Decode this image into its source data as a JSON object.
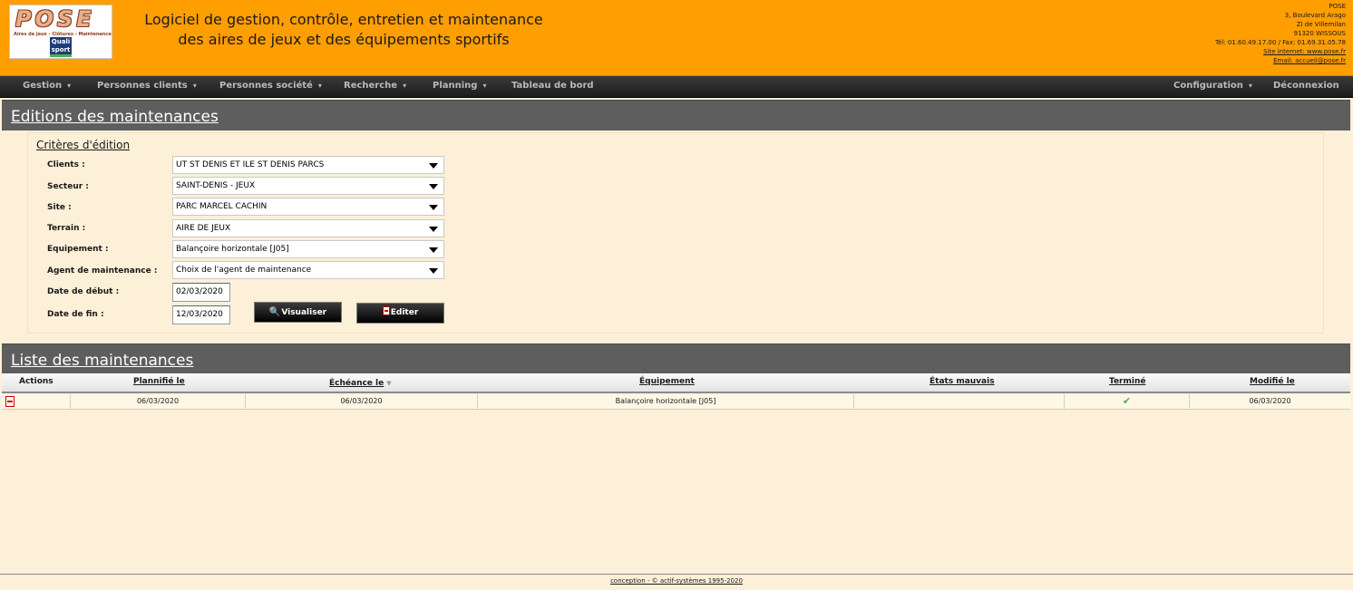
{
  "header": {
    "logo_text": "POSE",
    "logo_tagline": "Aires de jeux - Clôtures - Maintenance",
    "quali_badge": [
      "Quali",
      "sport"
    ],
    "title_line1": "Logiciel de gestion, contrôle, entretien et maintenance",
    "title_line2": "des aires de jeux et des équipements sportifs",
    "company": {
      "name": "POSE",
      "address1": "3, Boulevard Arago",
      "address2": "ZI de Villemilan",
      "city": "91320 WISSOUS",
      "phone": "Tél: 01.60.49.17.00 / Fax: 01.69.31.05.78",
      "website": "Site internet: www.pose.fr",
      "email": "Email: accueil@pose.fr"
    }
  },
  "nav": {
    "items": [
      {
        "label": "Gestion",
        "caret": "▾"
      },
      {
        "label": "Personnes clients",
        "caret": "▾"
      },
      {
        "label": "Personnes société",
        "caret": "▾"
      },
      {
        "label": "Recherche",
        "caret": "▾"
      },
      {
        "label": "Planning",
        "caret": "▾"
      },
      {
        "label": "Tableau de bord",
        "caret": ""
      },
      {
        "label": "Configuration",
        "caret": "▾"
      },
      {
        "label": "Déconnexion",
        "caret": ""
      }
    ]
  },
  "editions": {
    "section_title": "Editions des maintenances",
    "criteria_title": "Critères d'édition",
    "fields": {
      "clients": {
        "label": "Clients :",
        "value": "UT ST DENIS ET ILE ST DENIS PARCS"
      },
      "secteur": {
        "label": "Secteur :",
        "value": "SAINT-DENIS - JEUX"
      },
      "site": {
        "label": "Site :",
        "value": "PARC MARCEL CACHIN"
      },
      "terrain": {
        "label": "Terrain :",
        "value": "AIRE DE JEUX"
      },
      "equipement": {
        "label": "Equipement :",
        "value": "Balançoire horizontale [J05]"
      },
      "agent": {
        "label": "Agent de maintenance :",
        "value": "Choix de l'agent de maintenance"
      },
      "date_debut": {
        "label": "Date de début :",
        "value": "02/03/2020"
      },
      "date_fin": {
        "label": "Date de fin :",
        "value": "12/03/2020"
      }
    },
    "buttons": {
      "visualiser": "Visualiser",
      "editer": "Editer"
    }
  },
  "liste": {
    "section_title": "Liste des maintenances",
    "columns": [
      "Actions",
      "Plannifié le",
      "Échéance le",
      "Équipement",
      "États mauvais",
      "Terminé",
      "Modifié le"
    ],
    "sort_indicator": "▼",
    "rows": [
      {
        "plannifie": "06/03/2020",
        "echeance": "06/03/2020",
        "equipement": "Balançoire horizontale [J05]",
        "etats_mauvais": "",
        "termine": "✔",
        "modifie": "06/03/2020"
      }
    ]
  },
  "footer": {
    "text": "conception - © actif-systèmes 1995-2020"
  }
}
